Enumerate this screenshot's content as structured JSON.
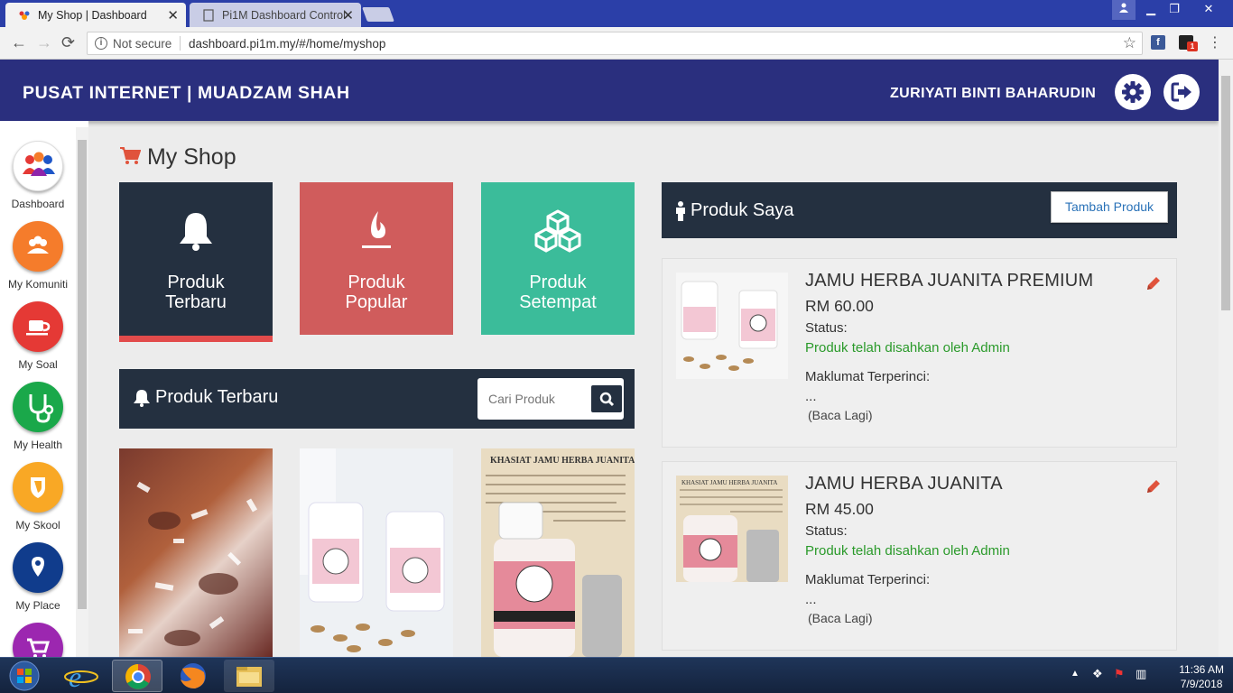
{
  "browser": {
    "tabs": [
      {
        "title": "My Shop | Dashboard",
        "active": true
      },
      {
        "title": "Pi1M Dashboard Control",
        "active": false
      }
    ],
    "security_label": "Not secure",
    "url": "dashboard.pi1m.my/#/home/myshop",
    "extension_badge": "1"
  },
  "header": {
    "title": "PUSAT INTERNET |  MUADZAM SHAH",
    "user_name": "ZURIYATI BINTI BAHARUDIN"
  },
  "sidebar": {
    "items": [
      {
        "label": "Dashboard",
        "icon": "people-group-icon",
        "color": "#ffffff"
      },
      {
        "label": "My Komuniti",
        "icon": "community-icon",
        "color": "#f57c2b"
      },
      {
        "label": "My Soal",
        "icon": "coffee-cup-icon",
        "color": "#e53935"
      },
      {
        "label": "My Health",
        "icon": "stethoscope-icon",
        "color": "#1aa84a"
      },
      {
        "label": "My Skool",
        "icon": "shield-icon",
        "color": "#f9a825"
      },
      {
        "label": "My Place",
        "icon": "map-pin-icon",
        "color": "#103c8c"
      },
      {
        "label": "",
        "icon": "cart-icon",
        "color": "#9c27b0"
      }
    ]
  },
  "page": {
    "title": "My Shop"
  },
  "tiles": [
    {
      "line1": "Produk",
      "line2": "Terbaru",
      "icon": "bell-icon",
      "color": "#243040",
      "selected": true
    },
    {
      "line1": "Produk",
      "line2": "Popular",
      "icon": "fire-icon",
      "color": "#d05c5c",
      "selected": false
    },
    {
      "line1": "Produk",
      "line2": "Setempat",
      "icon": "cubes-icon",
      "color": "#3bbc9a",
      "selected": false
    }
  ],
  "terbaru_panel": {
    "title": "Produk Terbaru",
    "search_placeholder": "Cari Produk"
  },
  "produk_saya": {
    "title": "Produk Saya",
    "add_button": "Tambah Produk",
    "products": [
      {
        "name": "JAMU HERBA JUANITA PREMIUM",
        "price": "RM 60.00",
        "status_label": "Status:",
        "status": "Produk telah disahkan oleh Admin",
        "details_label": "Maklumat Terperinci:",
        "details": "...",
        "read_more": "(Baca Lagi)"
      },
      {
        "name": "JAMU HERBA JUANITA",
        "price": "RM 45.00",
        "status_label": "Status:",
        "status": "Produk telah disahkan oleh Admin",
        "details_label": "Maklumat Terperinci:",
        "details": "...",
        "read_more": "(Baca Lagi)"
      }
    ]
  },
  "taskbar": {
    "time": "11:36 AM",
    "date": "7/9/2018"
  }
}
